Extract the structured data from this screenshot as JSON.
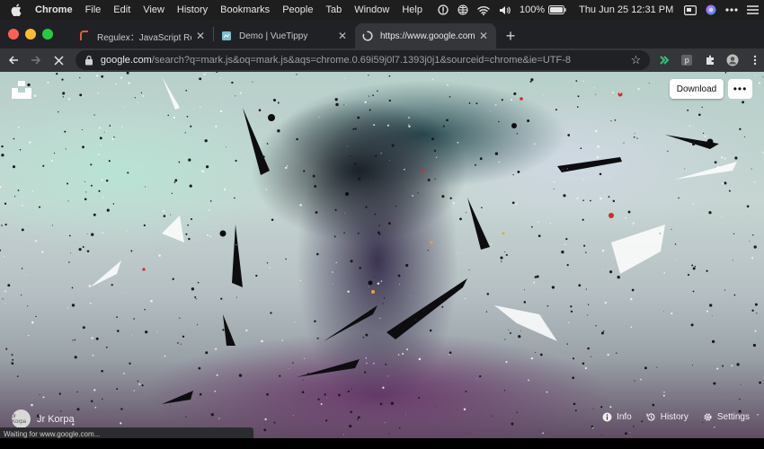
{
  "menubar": {
    "app_name": "Chrome",
    "items": [
      "File",
      "Edit",
      "View",
      "History",
      "Bookmarks",
      "People",
      "Tab",
      "Window",
      "Help"
    ],
    "battery": "100%",
    "datetime": "Thu Jun 25  12:31 PM"
  },
  "tabs": [
    {
      "title": "Regulex：JavaScript Regular E",
      "active": false
    },
    {
      "title": "Demo | VueTippy",
      "active": false
    },
    {
      "title": "https://www.google.com/search",
      "active": true
    }
  ],
  "toolbar": {
    "url_host": "google.com",
    "url_rest": "/search?q=mark.js&oq=mark.js&aqs=chrome.0.69i59j0l7.1393j0j1&sourceid=chrome&ie=UTF-8",
    "ext_p_label": "p"
  },
  "page": {
    "download_label": "Download",
    "more_label": "•••",
    "author_name": "Jr Korpa",
    "avatar_text": "Jr Korpa",
    "actions": {
      "info": "Info",
      "history": "History",
      "settings": "Settings"
    }
  },
  "status": "Waiting for www.google.com..."
}
